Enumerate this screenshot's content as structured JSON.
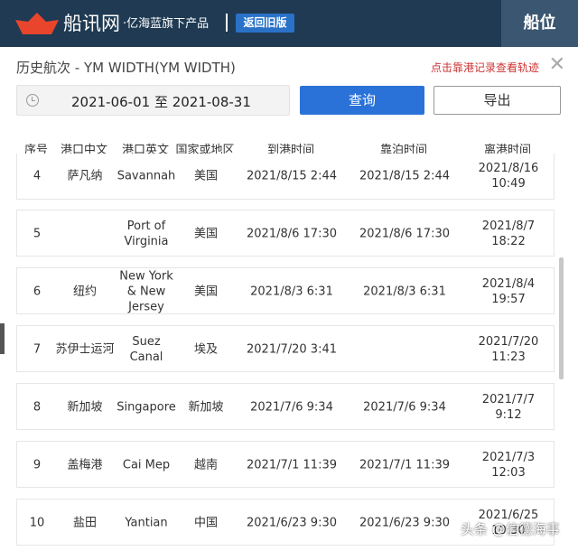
{
  "header": {
    "brand": "船讯网",
    "subtitle": "·亿海蓝旗下产品",
    "old_version": "返回旧版",
    "ship_position": "船位",
    "logo_color": "#e8452c",
    "bg": "#1f3a52"
  },
  "panel": {
    "title": "历史航次 - YM WIDTH(YM WIDTH)",
    "hint": "点击靠港记录查看轨迹",
    "close": "✕",
    "date_range": "2021-06-01 至 2021-08-31",
    "query": "查询",
    "export": "导出"
  },
  "table": {
    "headers": [
      "序号",
      "港口中文",
      "港口英文",
      "国家或地区",
      "到港时间",
      "靠泊时间",
      "离港时间"
    ],
    "rows": [
      [
        "4",
        "萨凡纳",
        "Savannah",
        "美国",
        "2021/8/15 2:44",
        "2021/8/15 2:44",
        "2021/8/16 10:49"
      ],
      [
        "5",
        "",
        "Port of\nVirginia",
        "美国",
        "2021/8/6 17:30",
        "2021/8/6 17:30",
        "2021/8/7 18:22"
      ],
      [
        "6",
        "纽约",
        "New York\n& New\nJersey",
        "美国",
        "2021/8/3 6:31",
        "2021/8/3 6:31",
        "2021/8/4 19:57"
      ],
      [
        "7",
        "苏伊士运河",
        "Suez\nCanal",
        "埃及",
        "2021/7/20 3:41",
        "",
        "2021/7/20 11:23"
      ],
      [
        "8",
        "新加坡",
        "Singapore",
        "新加坡",
        "2021/7/6 9:34",
        "2021/7/6 9:34",
        "2021/7/7 9:12"
      ],
      [
        "9",
        "盖梅港",
        "Cai Mep",
        "越南",
        "2021/7/1 11:39",
        "2021/7/1 11:39",
        "2021/7/3 12:03"
      ],
      [
        "10",
        "盐田",
        "Yantian",
        "中国",
        "2021/6/23 9:30",
        "2021/6/23 9:30",
        "2021/6/25 10:30"
      ]
    ]
  },
  "watermark": "头条 @信德海事"
}
